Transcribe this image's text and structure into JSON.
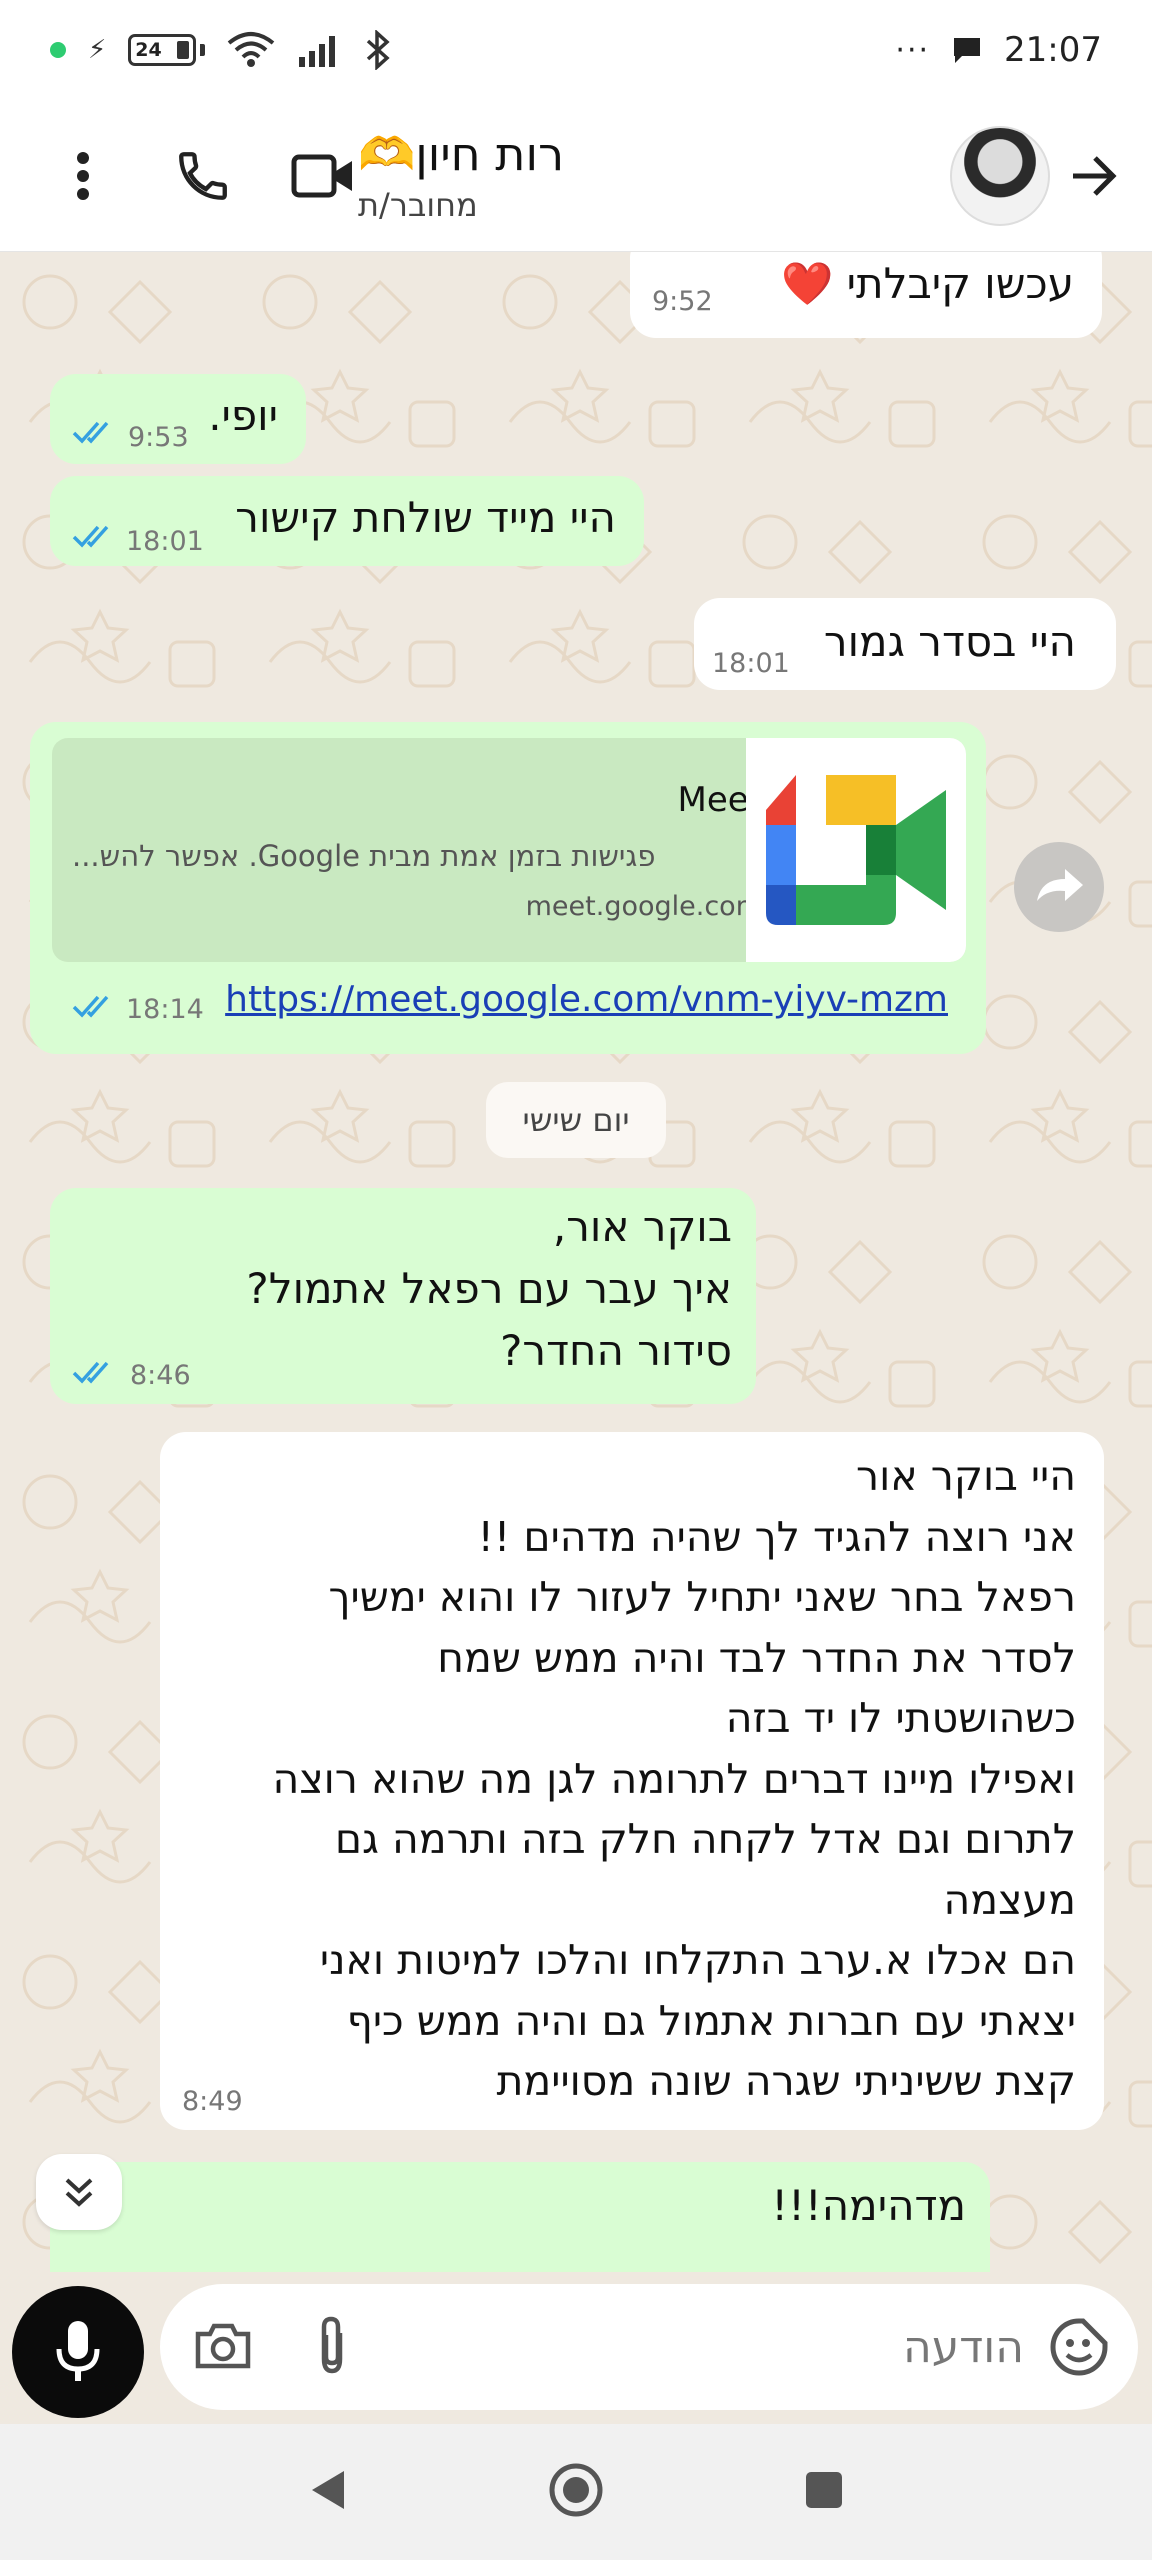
{
  "status_bar": {
    "battery_level": "24",
    "time": "21:07"
  },
  "header": {
    "contact_name": "רות חיון🫶",
    "contact_status": "מחובר/ת"
  },
  "messages": [
    {
      "direction": "incoming",
      "text": "עכשו קיבלתי ❤️",
      "time": "9:52"
    },
    {
      "direction": "outgoing",
      "text": "יופי.",
      "time": "9:53",
      "read": true
    },
    {
      "direction": "outgoing",
      "text": "היי מייד שולחת קישור",
      "time": "18:01",
      "read": true
    },
    {
      "direction": "incoming",
      "text": "היי בסדר גמור",
      "time": "18:01"
    },
    {
      "direction": "outgoing",
      "type": "link",
      "time": "18:14",
      "read": true,
      "link_preview": {
        "title": "Meet",
        "description": "פגישות בזמן אמת מבית Google. אפשר להש...",
        "domain": "meet.google.com"
      },
      "url": "https://meet.google.com/vnm-yiyv-mzm"
    },
    {
      "direction": "outgoing",
      "text": "בוקר אור,\nאיך עבר עם רפאל אתמול?\nסידור החדר?",
      "time": "8:46",
      "read": true
    },
    {
      "direction": "incoming",
      "text": "היי בוקר אור\nאני רוצה להגיד לך שהיה מדהים !!\nרפאל בחר שאני יתחיל לעזור לו והוא ימשיך\nלסדר את החדר לבד והיה ממש שמח\nכשהושטתי לו יד בזה\nואפילו מיינו דברים לתרומה לגן מה שהוא רוצה\nלתרום וגם אדל לקחה חלק בזה ותרמה גם\nמעצמה\nהם אכלו א.ערב התקלחו והלכו למיטות ואני\nיצאתי עם חברות אתמול גם והיה ממש כיף\nקצת ששיניתי שגרה שונה מסויימת",
      "time": "8:49"
    },
    {
      "direction": "outgoing",
      "text": "מדהימה!!!"
    }
  ],
  "date_separator": "יום שישי",
  "composer": {
    "placeholder": "הודעה"
  },
  "colors": {
    "outgoing_bubble": "#d9fdd3",
    "incoming_bubble": "#ffffff",
    "read_ticks": "#34a0e0",
    "chat_background": "#efe9e0",
    "link": "#1a3fb6"
  },
  "icons": [
    "wifi-icon",
    "signal-icon",
    "bluetooth-icon",
    "chat-notification-icon",
    "more-vert-icon",
    "phone-icon",
    "video-call-icon",
    "back-arrow-icon",
    "forward-icon",
    "chevrons-down-icon",
    "mic-icon",
    "camera-icon",
    "paperclip-icon",
    "sticker-icon",
    "nav-back-icon",
    "nav-home-icon",
    "nav-recents-icon"
  ]
}
